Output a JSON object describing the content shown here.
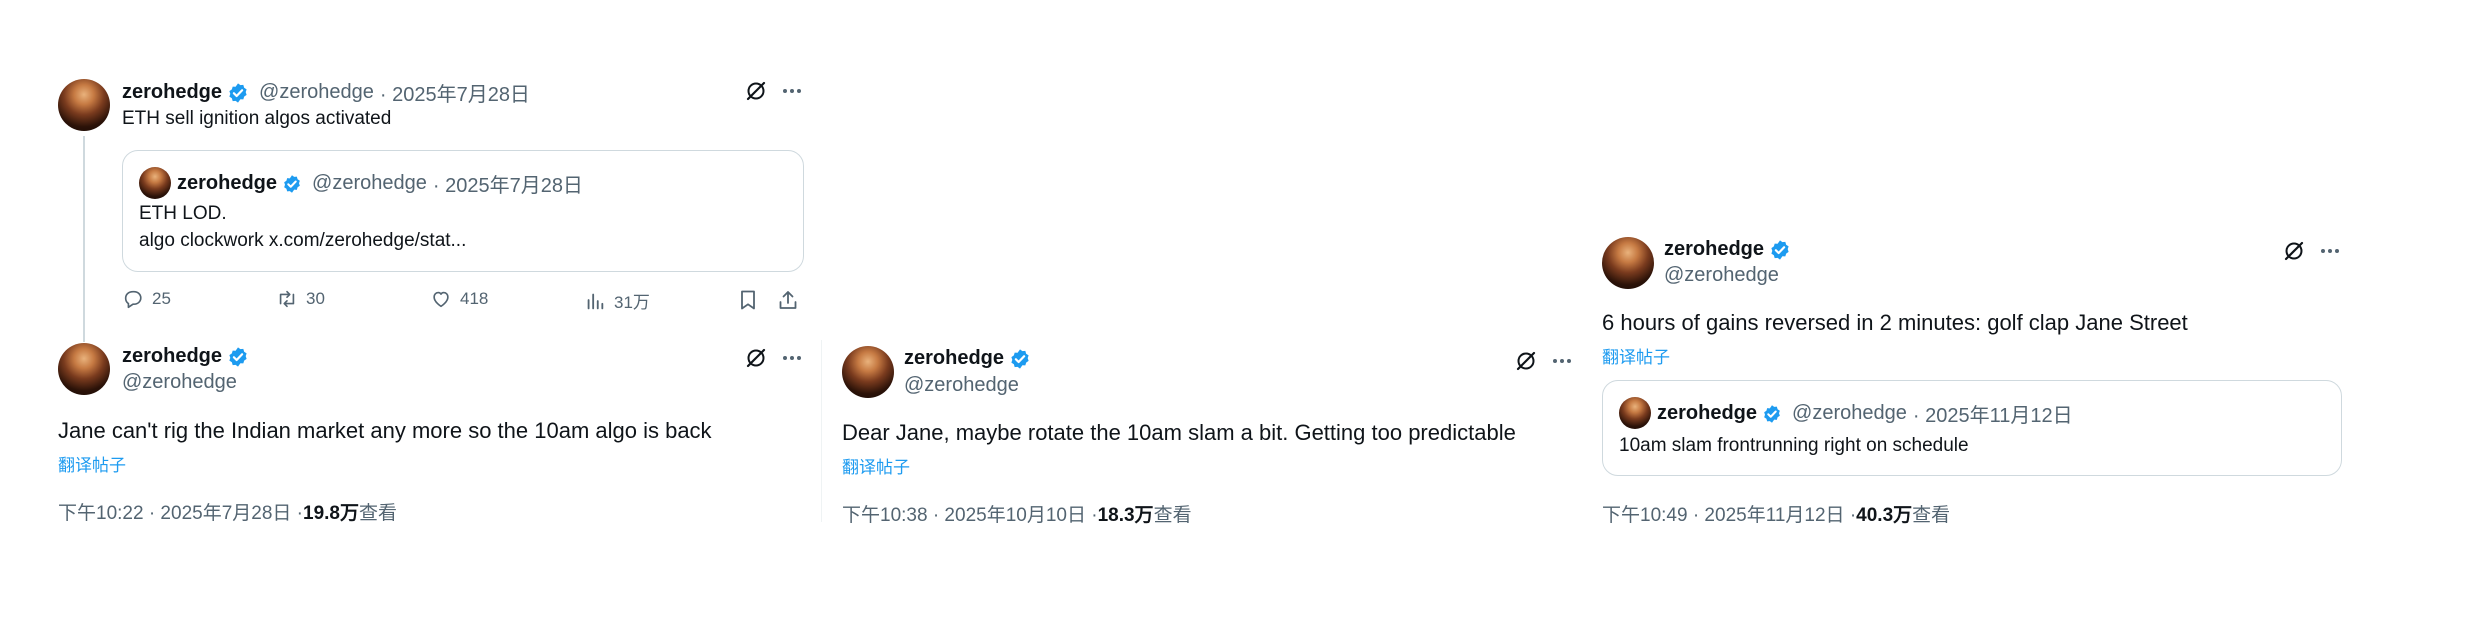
{
  "tweets": {
    "t1": {
      "name": "zerohedge",
      "handle": "@zerohedge",
      "date": "· 2025年7月28日",
      "text": "ETH sell ignition algos activated",
      "quote": {
        "name": "zerohedge",
        "handle": "@zerohedge",
        "date": "· 2025年7月28日",
        "line1": "ETH LOD.",
        "line2": "algo clockwork x.com/zerohedge/stat..."
      },
      "stats": {
        "replies": "25",
        "retweets": "30",
        "likes": "418",
        "views": "31万"
      }
    },
    "t2": {
      "name": "zerohedge",
      "handle": "@zerohedge",
      "text": "Jane can't rig the Indian market any more so the 10am algo is back",
      "translate": "翻译帖子",
      "meta": "下午10:22 · 2025年7月28日 · ",
      "views": "19.8万",
      "views_suffix": " 查看"
    },
    "t3": {
      "name": "zerohedge",
      "handle": "@zerohedge",
      "text": "Dear Jane, maybe rotate the 10am slam a bit. Getting too predictable",
      "translate": "翻译帖子",
      "meta": "下午10:38 · 2025年10月10日 · ",
      "views": "18.3万",
      "views_suffix": " 查看"
    },
    "t4": {
      "name": "zerohedge",
      "handle": "@zerohedge",
      "text": "6 hours of gains reversed in 2 minutes: golf clap Jane Street",
      "translate": "翻译帖子",
      "quote": {
        "name": "zerohedge",
        "handle": "@zerohedge",
        "date": "· 2025年11月12日",
        "line1": "10am slam frontrunning right on schedule"
      },
      "meta": "下午10:49 · 2025年11月12日 · ",
      "views": "40.3万",
      "views_suffix": " 查看"
    }
  },
  "colors": {
    "accent": "#1d9bf0",
    "muted": "#536471",
    "border": "#cfd9de"
  },
  "icons": [
    "verified-badge-icon",
    "grok-icon",
    "more-icon",
    "reply-icon",
    "retweet-icon",
    "like-icon",
    "views-icon",
    "bookmark-icon",
    "share-icon"
  ]
}
